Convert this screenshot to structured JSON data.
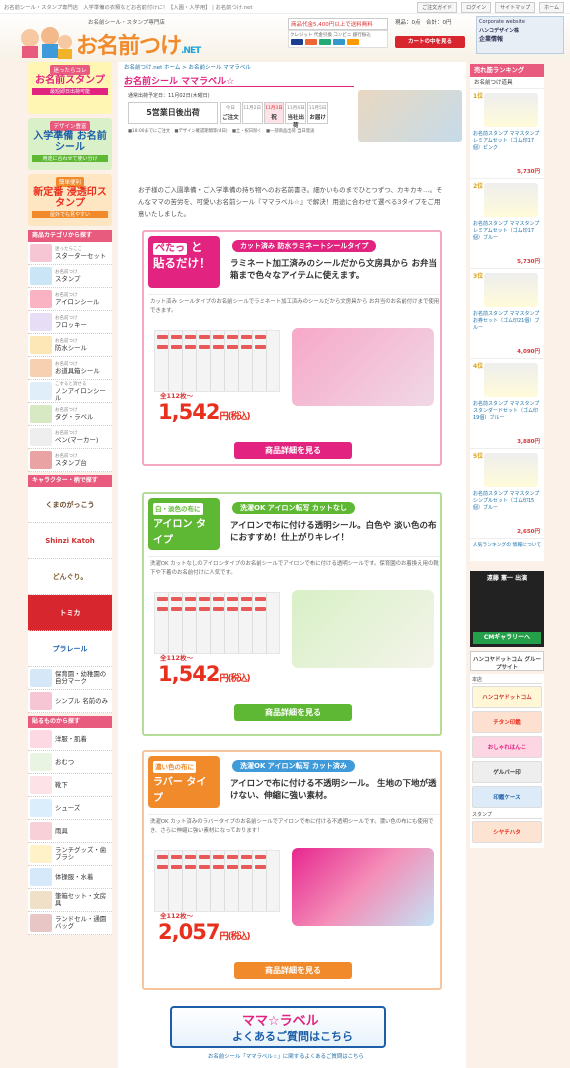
{
  "topbar": {
    "text": "お名前シール・スタンプ専門店　入学準備の衣類などお名前付けに！【入園・入学用】 | お名前つけ.net",
    "links": [
      "ご注文ガイド",
      "ログイン",
      "サイトマップ",
      "ホーム"
    ]
  },
  "header": {
    "sub": "お名前シール・スタンプ専門店",
    "logo": "お名前つけ",
    "logo_suffix": ".NET",
    "ship": "商品代金5,400円以上で送料無料",
    "pay_label": "クレジット 代金引換 コンビニ 銀行振込",
    "cart_info": "現品：0点　合計：0円",
    "cart_btn": "カートの中を見る",
    "ad_line1": "Corporate website",
    "ad_line2": "ハンコデザイン株",
    "ad_line3": "企業情報"
  },
  "left": {
    "banners": [
      {
        "s": "迷ったらコレ",
        "b": "お名前スタンプ",
        "n": "最短即日出荷可能"
      },
      {
        "s": "デザイン豊富",
        "b": "入学準備 お名前シール",
        "n": "用途に合わせて使い分け"
      },
      {
        "s": "簡単便利",
        "b": "新定番 浸透印スタンプ",
        "n": "屋外でも見やすい"
      }
    ],
    "cat_head": "商品カテゴリから探す",
    "cats": [
      {
        "s": "迷ったらここ",
        "l": "スターターセット"
      },
      {
        "s": "お名前つけ",
        "l": "スタンプ"
      },
      {
        "s": "お名前つけ",
        "l": "アイロンシール"
      },
      {
        "s": "お名前つけ",
        "l": "フロッキー"
      },
      {
        "s": "お名前つけ",
        "l": "防水シール"
      },
      {
        "s": "お名前つけ",
        "l": "お道具箱シール"
      },
      {
        "s": "こすると消せる",
        "l": "ノンアイロンシール"
      },
      {
        "s": "お名前つけ",
        "l": "タグ・ラベル"
      },
      {
        "s": "お名前つけ",
        "l": "ペン(マーカー)"
      },
      {
        "s": "お名前つけ",
        "l": "スタンプ台"
      }
    ],
    "chara_head": "キャラクター・柄で探す",
    "charas": [
      "くまのがっこう",
      "Shinzi Katoh",
      "どんぐり。",
      "トミカ",
      "プラレール"
    ],
    "extra": [
      {
        "l": "保育園・幼稚園の 自分マーク"
      },
      {
        "l": "シンプル 名前のみ"
      }
    ],
    "use_head": "貼るものから探す",
    "uses": [
      "洋服・肌着",
      "おむつ",
      "靴下",
      "シューズ",
      "雨具",
      "ランチグッズ・歯ブラシ",
      "体操服・水着",
      "筆箱セット・文房具",
      "ランドセル・通園バッグ"
    ]
  },
  "main": {
    "breadcrumb": "お名前つけ.net ホーム > お名前シール ママラベル",
    "title": "お名前シール ママラベル☆",
    "date": "通常出荷予定日：11月02日(木曜日)",
    "shipping": "5営業日後出荷",
    "calendar": [
      {
        "t": "今日",
        "d": "ご注文"
      },
      {
        "t": "11月2日",
        "d": ""
      },
      {
        "t": "11月3日",
        "d": "祝"
      },
      {
        "t": "11月4日",
        "d": "当社出荷"
      },
      {
        "t": "11月5日",
        "d": "お届け"
      }
    ],
    "legend": "■18:00までにご注文　■デザイン確認期間等(4日)　■土・祝日除く　■一部商品出荷 当日発送",
    "intro": "お子様のご入園準備・ご入学準備の持ち物へのお名前書き。細かいものまでひとつずつ、カキカキ…。そんなママの苦労を、可愛いお名前シール『ママラベル☆』で解決！用途に合わせて選べる3タイプをご用意いたしました。",
    "cards": [
      {
        "tag1": "ぺたっ",
        "tag2": "と",
        "tag3": "貼るだけ！",
        "pill": "カット済み 防水ラミネートシールタイプ",
        "head": "ラミネート加工済みのシールだから文房具から お弁当箱まで色々なアイテムに使えます。",
        "desc": "カット済み シールタイプのお名前シールでラミネート加工済みのシールだから文房具から お弁当のお名前付けまで使用できます。",
        "from": "全112枚～",
        "price": "1,542",
        "unit": "円(税込)",
        "btn": "商品詳細を見る"
      },
      {
        "tag1": "白・淡色の布に",
        "tag2": "",
        "tag3": "アイロン タイプ",
        "pill": "洗濯OK アイロン転写 カットなし",
        "head": "アイロンで布に付ける透明シール。白色や 淡い色の布におすすめ！仕上がりキレイ！",
        "desc": "洗濯OK カットなしのアイロンタイプのお名前シールでアイロンで布に付ける透明シールです。保育園のお着換え用の靴下や下着のお名前付けに人気です。",
        "from": "全112枚～",
        "price": "1,542",
        "unit": "円(税込)",
        "btn": "商品詳細を見る"
      },
      {
        "tag1": "濃い色の布に",
        "tag2": "",
        "tag3": "ラバー タイプ",
        "pill": "洗濯OK アイロン転写 カット済み",
        "head": "アイロンで布に付ける不透明シール。 生地の下地が透けない、伸縮に強い素材。",
        "desc": "洗濯OK カット済みのラバータイプのお名前シールでアイロンで布に付ける不透明シールです。濃い色の布にも使用でき、さらに伸縮に強い素材になっております！",
        "from": "全112枚～",
        "price": "2,057",
        "unit": "円(税込)",
        "btn": "商品詳細を見る"
      }
    ],
    "bot_t1": "ママ☆ラベル",
    "bot_t2": "よくあるご質問はこちら",
    "bot_link": "お名前シール「ママラベル☆」に関するよくあるご質問はこちら"
  },
  "right": {
    "rank_head": "売れ筋ランキング",
    "rank_sub": "お名前つけ道具",
    "ranks": [
      {
        "no": "1位",
        "nm": "お名前スタンプ ママスタンプ レミアムセット（ゴム印17個）ピンク",
        "pr": "5,730円"
      },
      {
        "no": "2位",
        "nm": "お名前スタンプ ママスタンプ レミアムセット（ゴム印17個）ブルー",
        "pr": "5,730円"
      },
      {
        "no": "3位",
        "nm": "お名前スタンプ ママスタンプ お券セット（ゴム印21個）ブルー",
        "pr": "4,090円"
      },
      {
        "no": "4位",
        "nm": "お名前スタンプ ママスタンプ スタンダードセット（ゴム印19個）ブルー",
        "pr": "3,880円"
      },
      {
        "no": "5位",
        "nm": "お名前スタンプ ママスタンプ シンプルセット（ゴム印15個）ブルー",
        "pr": "2,650円"
      }
    ],
    "more": "人気ランキングの 情報について",
    "cm_name": "遠藤 憲一 出演",
    "cm_btn": "CMギャラリーへ",
    "group": "ハンコヤドットコム グループサイト",
    "shop_head": "本店",
    "shops": [
      "ハンコヤドットコム",
      "チタン印鑑",
      "おしゃれはんこ",
      "ゲルバー印",
      "印鑑ケース"
    ],
    "stamp_head": "スタンプ",
    "stamp": "シヤチハタ"
  },
  "colors": {
    "pink": "#e2237f",
    "accent_red": "#e8301e",
    "blue": "#1c5fa8",
    "green": "#5fb833",
    "orange": "#f08a2a"
  }
}
